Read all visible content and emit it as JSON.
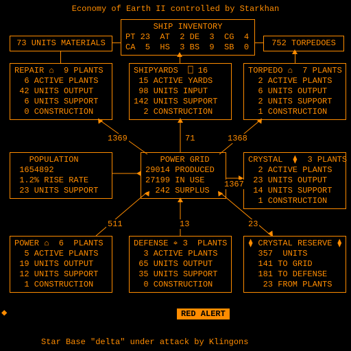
{
  "title": "Economy of Earth II  controlled by Starkhan",
  "materials": "73 UNITS MATERIALS",
  "torpedoes": "752 TORPEDOES",
  "ship_inventory": {
    "header": "SHIP INVENTORY",
    "line1": "PT 23  AT  2 DE  3  CG  4",
    "line2": "CA  5  HS  3 BS  9  SB  0"
  },
  "repair": {
    "header": "REPAIR ⌂  9 PLANTS",
    "l1": "  6 ACTIVE PLANTS",
    "l2": " 42 UNITS OUTPUT",
    "l3": "  6 UNITS SUPPORT",
    "l4": "  0 CONSTRUCTION"
  },
  "shipyards": {
    "header": "SHIPYARDS  ⎕ 16",
    "l1": " 15 ACTIVE YARDS",
    "l2": " 98 UNITS INPUT",
    "l3": "142 UNITS SUPPORT",
    "l4": "  2 CONSTRUCTION"
  },
  "torpedo": {
    "header": "TORPEDO ⌂  7 PLANTS",
    "l1": "  2 ACTIVE PLANTS",
    "l2": "  6 UNITS OUTPUT",
    "l3": "  2 UNITS SUPPORT",
    "l4": "  1 CONSTRUCTION"
  },
  "population": {
    "header": "   POPULATION",
    "l1": " 1654892",
    "l2": " 1.2% RISE RATE",
    "l3": " 23 UNITS SUPPORT"
  },
  "power_grid": {
    "header": "   POWER GRID",
    "l1": "29014 PRODUCED",
    "l2": "27199 IN USE",
    "l3": "  242 SURPLUS"
  },
  "crystal": {
    "header": "CRYSTAL  ⧫  3 PLANTS",
    "l1": "  2 ACTIVE PLANTS",
    "l2": " 23 UNITS OUTPUT",
    "l3": " 14 UNITS SUPPORT",
    "l4": "  1 CONSTRUCTION"
  },
  "power": {
    "header": "POWER ⌂  6  PLANTS",
    "l1": "  5 ACTIVE PLANTS",
    "l2": " 19 UNITS OUTPUT",
    "l3": " 12 UNITS SUPPORT",
    "l4": "  1 CONSTRUCTION"
  },
  "defense": {
    "header": "DEFENSE ⌖ 3  PLANTS",
    "l1": "  3 ACTIVE PLANTS",
    "l2": " 65 UNITS OUTPUT",
    "l3": " 35 UNITS SUPPORT",
    "l4": "  0 CONSTRUCTION"
  },
  "crystal_reserve": {
    "header": "⧫ CRYSTAL RESERVE ⧫",
    "l1": "  357  UNITS",
    "l2": "  141 TO GRID",
    "l3": "  181 TO DEFENSE",
    "l4": "   23 FROM PLANTS"
  },
  "edges": {
    "e1": "1369",
    "e2": "71",
    "e3": "1368",
    "e4": "1367",
    "e5": "511",
    "e6": "13",
    "e7": "23"
  },
  "red_alert": "RED ALERT",
  "alert_msg": "Star Base \"delta\" under attack by Klingons"
}
